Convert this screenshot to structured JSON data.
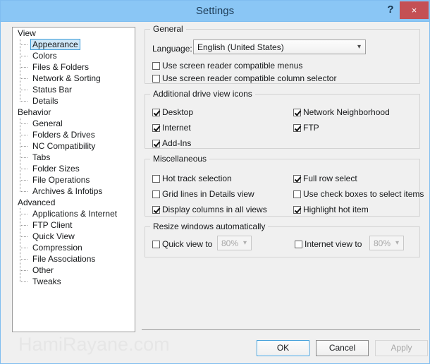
{
  "window": {
    "title": "Settings",
    "help_label": "?",
    "close_label": "×",
    "titlebar_color": "#8ac6f5",
    "close_color": "#c45054",
    "accent_color": "#3b9bd8"
  },
  "tree": {
    "groups": [
      {
        "label": "View",
        "items": [
          {
            "label": "Appearance",
            "selected": true
          },
          {
            "label": "Colors",
            "selected": false
          },
          {
            "label": "Files & Folders",
            "selected": false
          },
          {
            "label": "Network & Sorting",
            "selected": false
          },
          {
            "label": "Status Bar",
            "selected": false
          },
          {
            "label": "Details",
            "selected": false
          }
        ]
      },
      {
        "label": "Behavior",
        "items": [
          {
            "label": "General",
            "selected": false
          },
          {
            "label": "Folders & Drives",
            "selected": false
          },
          {
            "label": "NC Compatibility",
            "selected": false
          },
          {
            "label": "Tabs",
            "selected": false
          },
          {
            "label": "Folder Sizes",
            "selected": false
          },
          {
            "label": "File Operations",
            "selected": false
          },
          {
            "label": "Archives & Infotips",
            "selected": false
          }
        ]
      },
      {
        "label": "Advanced",
        "items": [
          {
            "label": "Applications & Internet",
            "selected": false
          },
          {
            "label": "FTP Client",
            "selected": false
          },
          {
            "label": "Quick View",
            "selected": false
          },
          {
            "label": "Compression",
            "selected": false
          },
          {
            "label": "File Associations",
            "selected": false
          },
          {
            "label": "Other",
            "selected": false
          },
          {
            "label": "Tweaks",
            "selected": false
          }
        ]
      }
    ]
  },
  "general": {
    "title": "General",
    "language_label": "Language:",
    "language_value": "English (United States)",
    "dropdown_icon": "chevron-down-icon",
    "checkboxes": [
      {
        "label": "Use screen reader compatible menus",
        "checked": false
      },
      {
        "label": "Use screen reader compatible column selector",
        "checked": false
      }
    ]
  },
  "drive_icons": {
    "title": "Additional drive view icons",
    "left": [
      {
        "label": "Desktop",
        "checked": true
      },
      {
        "label": "Internet",
        "checked": true
      },
      {
        "label": "Add-Ins",
        "checked": true
      }
    ],
    "right": [
      {
        "label": "Network Neighborhood",
        "checked": true
      },
      {
        "label": "FTP",
        "checked": true
      }
    ]
  },
  "miscellaneous": {
    "title": "Miscellaneous",
    "left": [
      {
        "label": "Hot track selection",
        "checked": false
      },
      {
        "label": "Grid lines in Details view",
        "checked": false
      },
      {
        "label": "Display columns in all views",
        "checked": true
      }
    ],
    "right": [
      {
        "label": "Full row select",
        "checked": true
      },
      {
        "label": "Use check boxes to select items",
        "checked": false
      },
      {
        "label": "Highlight hot item",
        "checked": true
      }
    ]
  },
  "resize": {
    "title": "Resize windows automatically",
    "quick_view": {
      "label": "Quick view to",
      "checked": false,
      "value": "80%",
      "enabled": false
    },
    "internet_view": {
      "label": "Internet view to",
      "checked": false,
      "value": "80%",
      "enabled": false
    }
  },
  "footer": {
    "watermark": "HamiRayane.com",
    "ok_label": "OK",
    "cancel_label": "Cancel",
    "apply_label": "Apply"
  }
}
